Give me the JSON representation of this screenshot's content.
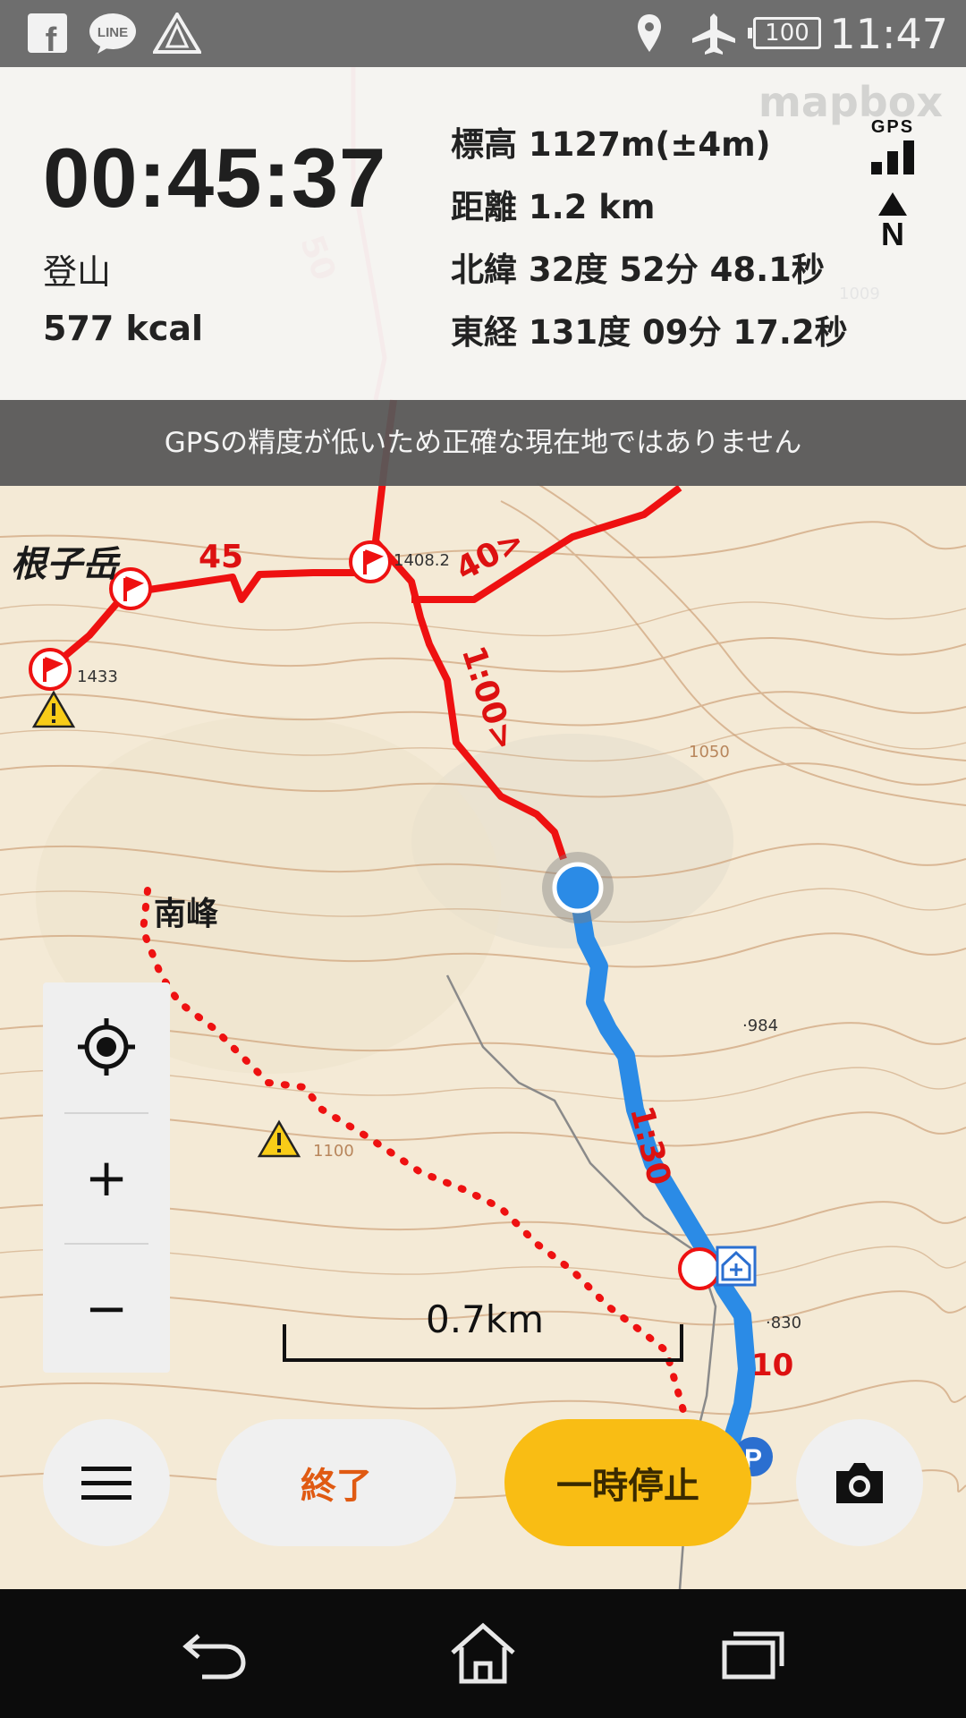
{
  "status_bar": {
    "time": "11:47",
    "battery": "100",
    "icons": [
      "facebook-icon",
      "line-icon",
      "warning-icon",
      "location-pin-icon",
      "airplane-icon",
      "battery-icon"
    ]
  },
  "tracking": {
    "elapsed": "00:45:37",
    "activity": "登山",
    "calories": "577 kcal",
    "altitude": "標高 1127m(±4m)",
    "distance": "距離 1.2 km",
    "latitude": "北緯 32度 52分 48.1秒",
    "longitude": "東経 131度 09分 17.2秒",
    "gps_label": "GPS",
    "north_label": "N"
  },
  "attribution": {
    "logo": "mapbox"
  },
  "toast": {
    "message": "GPSの精度が低いため正確な現在地ではありません"
  },
  "map": {
    "places": [
      {
        "name": "根子岳"
      },
      {
        "name": "南峰"
      }
    ],
    "route_times": [
      "45",
      "40>",
      "1:00>",
      "1:30",
      "10",
      "50"
    ],
    "elevation_points": [
      "1408.2",
      "1433",
      "·984",
      "·830",
      "1009",
      "1050",
      "1100"
    ],
    "scale": "0.7km",
    "colors": {
      "planned_route": "#ee1111",
      "track": "#2b8be6",
      "current_location": "#2b8be6"
    }
  },
  "zoom_controls": {
    "locate": "crosshair-icon",
    "zoom_in": "+",
    "zoom_out": "−"
  },
  "actions": {
    "menu_icon": "hamburger-menu-icon",
    "end_label": "終了",
    "pause_label": "一時停止",
    "camera_icon": "camera-icon",
    "end_color": "#e05a12",
    "pause_color": "#f9bd14"
  },
  "nav_bar": {
    "icons": [
      "back-icon",
      "home-icon",
      "recent-apps-icon"
    ]
  }
}
